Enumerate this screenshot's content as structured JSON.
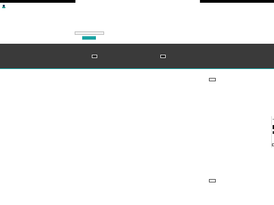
{
  "topbar": {
    "center_text": "",
    "right_text": ""
  },
  "notice": {
    "text": "",
    "link": ""
  },
  "breadcrumb": {
    "line1": "",
    "line2": ""
  },
  "search": {
    "placeholder_text": "",
    "button_label": ""
  },
  "cards": [
    {
      "title": "",
      "button": ""
    },
    {
      "title": "",
      "button": ""
    }
  ],
  "promos": [
    {
      "kicker": "",
      "title": "",
      "body": "",
      "button": ""
    },
    {
      "kicker": "",
      "body": "",
      "button": ""
    }
  ],
  "colors": {
    "accent": "#1aa3a3",
    "dark_band": "#3a3a3a",
    "topbar": "#000000",
    "logo_primary": "#1d3557",
    "logo_secondary": "#2a9d8f"
  },
  "icons": {
    "logo": "brand-logo"
  }
}
